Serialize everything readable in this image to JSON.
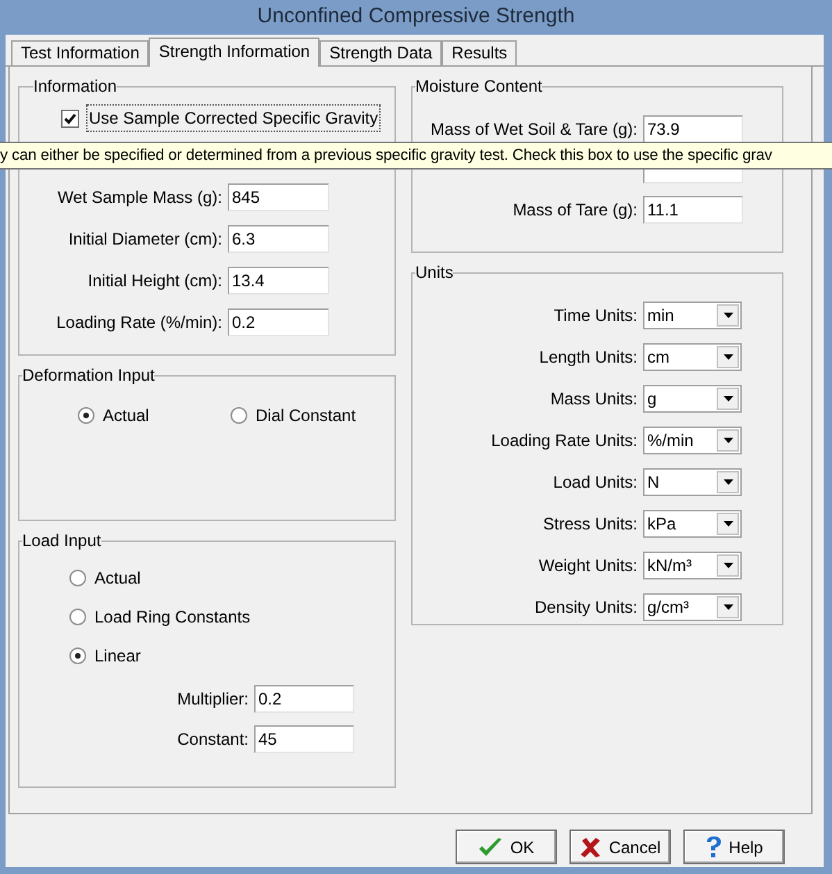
{
  "window": {
    "title": "Unconfined Compressive Strength"
  },
  "tabs": [
    {
      "label": "Test Information",
      "selected": false
    },
    {
      "label": "Strength Information",
      "selected": true
    },
    {
      "label": "Strength Data",
      "selected": false
    },
    {
      "label": "Results",
      "selected": false
    }
  ],
  "information": {
    "title": "Information",
    "checkbox": {
      "label": "Use Sample Corrected Specific Gravity",
      "checked": true
    },
    "fields": [
      {
        "label": "Wet Sample Mass (g):",
        "value": "845"
      },
      {
        "label": "Initial Diameter (cm):",
        "value": "6.3"
      },
      {
        "label": "Initial Height (cm):",
        "value": "13.4"
      },
      {
        "label": "Loading Rate (%/min):",
        "value": "0.2"
      }
    ]
  },
  "deformation_input": {
    "title": "Deformation Input",
    "options": [
      {
        "label": "Actual",
        "selected": true
      },
      {
        "label": "Dial Constant",
        "selected": false
      }
    ]
  },
  "load_input": {
    "title": "Load Input",
    "options": [
      {
        "label": "Actual",
        "selected": false
      },
      {
        "label": "Load Ring Constants",
        "selected": false
      },
      {
        "label": "Linear",
        "selected": true
      }
    ],
    "fields": [
      {
        "label": "Multiplier:",
        "value": "0.2"
      },
      {
        "label": "Constant:",
        "value": "45"
      }
    ]
  },
  "moisture_content": {
    "title": "Moisture Content",
    "fields": [
      {
        "label": "Mass of Wet Soil & Tare (g):",
        "value": "73.9"
      },
      {
        "label": "Mass of Tare (g):",
        "value": "11.1"
      }
    ]
  },
  "units": {
    "title": "Units",
    "fields": [
      {
        "label": "Time Units:",
        "value": "min"
      },
      {
        "label": "Length Units:",
        "value": "cm"
      },
      {
        "label": "Mass Units:",
        "value": "g"
      },
      {
        "label": "Loading Rate Units:",
        "value": "%/min"
      },
      {
        "label": "Load Units:",
        "value": "N"
      },
      {
        "label": "Stress Units:",
        "value": "kPa"
      },
      {
        "label": "Weight Units:",
        "value": "kN/m³"
      },
      {
        "label": "Density Units:",
        "value": "g/cm³"
      }
    ]
  },
  "tooltip": "y can either be specified or determined from a previous specific gravity test. Check this box to use the specific grav",
  "buttons": [
    {
      "kind": "ok",
      "label": "OK"
    },
    {
      "kind": "cancel",
      "label": "Cancel"
    },
    {
      "kind": "help",
      "label": "Help"
    }
  ]
}
